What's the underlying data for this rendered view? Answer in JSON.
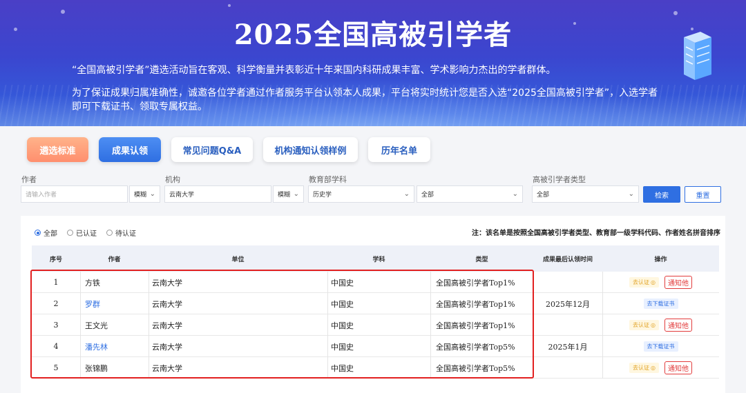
{
  "banner": {
    "title": "2025全国高被引学者",
    "line1": "“全国高被引学者”遴选活动旨在客观、科学衡量并表彰近十年来国内科研成果丰富、学术影响力杰出的学者群体。",
    "line2": "为了保证成果归属准确性，诚邀各位学者通过作者服务平台认领本人成果，平台将实时统计您是否入选“2025全国高被引学者”，入选学者",
    "line3": "即可下载证书、领取专属权益。"
  },
  "tabs": [
    "遴选标准",
    "成果认领",
    "常见问题Q&A",
    "机构通知认领样例",
    "历年名单"
  ],
  "filters": {
    "author_label": "作者",
    "author_placeholder": "请输入作者",
    "author_mode": "模糊",
    "org_label": "机构",
    "org_value": "云南大学",
    "org_mode": "模糊",
    "subject_label": "教育部学科",
    "subject_value": "历史学",
    "subject_sub_value": "全部",
    "type_label": "高被引学者类型",
    "type_value": "全部",
    "search_label": "检索",
    "reset_label": "重置"
  },
  "radios": [
    "全部",
    "已认证",
    "待认证"
  ],
  "note": "注：该名单是按照全国高被引学者类型、教育部一级学科代码、作者姓名拼音排序",
  "columns": [
    "序号",
    "作者",
    "单位",
    "学科",
    "类型",
    "成果最后认领时间",
    "操作"
  ],
  "rows": [
    {
      "no": "1",
      "author": "方铁",
      "unit": "云南大学",
      "subject": "中国史",
      "type": "全国高被引学者Top1%",
      "time": "",
      "action1": "去认证",
      "action2": "通知他"
    },
    {
      "no": "2",
      "author": "罗群",
      "unit": "云南大学",
      "subject": "中国史",
      "type": "全国高被引学者Top1%",
      "time": "2025年12月",
      "action1": "去下载证书",
      "action2": ""
    },
    {
      "no": "3",
      "author": "王文光",
      "unit": "云南大学",
      "subject": "中国史",
      "type": "全国高被引学者Top1%",
      "time": "",
      "action1": "去认证",
      "action2": "通知他"
    },
    {
      "no": "4",
      "author": "潘先林",
      "unit": "云南大学",
      "subject": "中国史",
      "type": "全国高被引学者Top5%",
      "time": "2025年1月",
      "action1": "去下载证书",
      "action2": ""
    },
    {
      "no": "5",
      "author": "张锦鹏",
      "unit": "云南大学",
      "subject": "中国史",
      "type": "全国高被引学者Top5%",
      "time": "",
      "action1": "去认证",
      "action2": "通知他"
    }
  ],
  "colors": {
    "primary": "#2f6fe2",
    "danger": "#e21f1f",
    "warn": "#e0a020"
  }
}
